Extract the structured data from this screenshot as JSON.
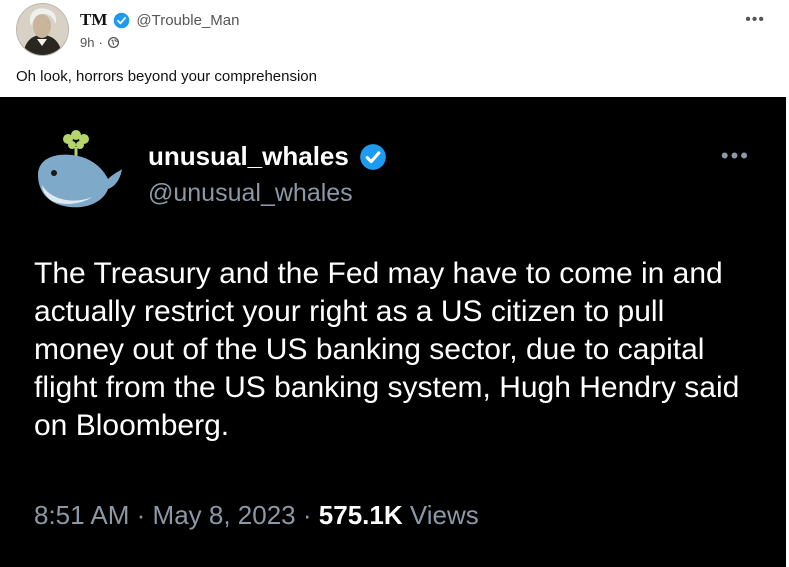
{
  "post": {
    "display_name": "TM",
    "handle": "@Trouble_Man",
    "time": "9h",
    "separator": "·",
    "more": "•••",
    "text": "Oh look, horrors beyond your comprehension",
    "icons": [
      "avatar",
      "verified-badge-icon",
      "globe-icon",
      "more-options-icon"
    ]
  },
  "embedded_tweet": {
    "display_name": "unusual_whales",
    "handle": "@unusual_whales",
    "more": "•••",
    "body": "The Treasury and the Fed may have to come in and actually restrict your right as a US citizen to pull money out of the US banking sector, due to capital flight from the US banking system, Hugh Hendry said on Bloomberg.",
    "time": "8:51 AM",
    "date": "May 8, 2023",
    "dot": "·",
    "views_count": "575.1K",
    "views_label": "Views",
    "icons": [
      "whale-logo-icon",
      "verified-badge-icon"
    ]
  },
  "colors": {
    "verified": "#1d9bf0",
    "tweet_bg": "#000000",
    "muted": "#8b98a5"
  }
}
